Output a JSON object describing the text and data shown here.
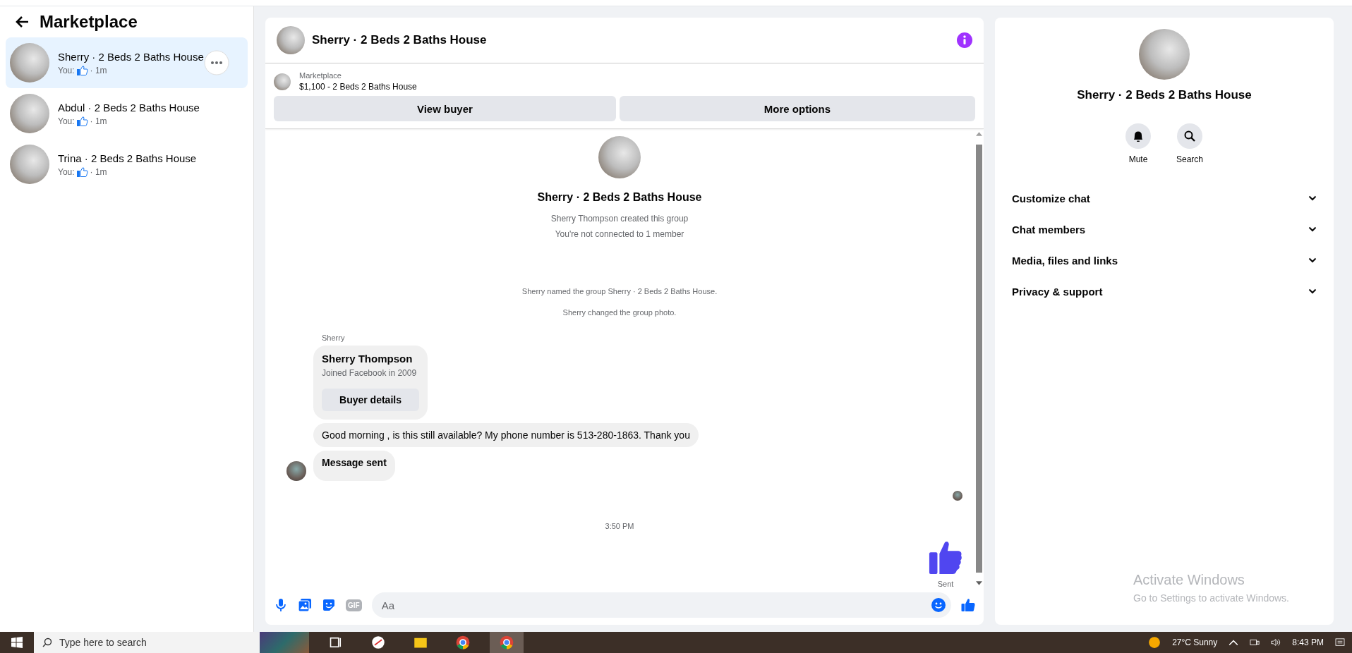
{
  "sidebar": {
    "title": "Marketplace",
    "conversations": [
      {
        "name": "Sherry · 2 Beds 2 Baths House",
        "preview": "You:",
        "time": "· 1m",
        "selected": true
      },
      {
        "name": "Abdul · 2 Beds 2 Baths House",
        "preview": "You:",
        "time": "· 1m",
        "selected": false
      },
      {
        "name": "Trina · 2 Beds 2 Baths House",
        "preview": "You:",
        "time": "· 1m",
        "selected": false
      }
    ]
  },
  "chat": {
    "title": "Sherry · 2 Beds 2 Baths House",
    "listing": {
      "label": "Marketplace",
      "title": "$1,100 - 2 Beds 2 Baths House"
    },
    "buttons": [
      "View buyer",
      "More options"
    ],
    "intro": {
      "title": "Sherry · 2 Beds 2 Baths House",
      "lines": [
        "Sherry Thompson created this group",
        "You're not connected to 1 member"
      ]
    },
    "notices": [
      "Sherry named the group Sherry · 2 Beds 2 Baths House.",
      "Sherry changed the group photo."
    ],
    "sender": "Sherry",
    "card": {
      "name": "Sherry Thompson",
      "subtitle": "Joined Facebook in 2009",
      "button": "Buyer details"
    },
    "bubbles": [
      {
        "text": "Good morning , is this still available? My phone number is 513-280-1863. Thank you",
        "bold": false
      },
      {
        "text": "Message sent",
        "bold": true
      }
    ],
    "time": "3:50 PM",
    "status": "Sent",
    "composer": {
      "gif": "GIF",
      "placeholder": "Aa"
    }
  },
  "details": {
    "title": "Sherry · 2 Beds 2 Baths House",
    "actions": [
      {
        "label": "Mute",
        "kind": "bell"
      },
      {
        "label": "Search",
        "kind": "search"
      }
    ],
    "sections": [
      {
        "label": "Customize chat",
        "expanded": false
      },
      {
        "label": "Chat members",
        "expanded": false
      },
      {
        "label": "Media, files and links",
        "expanded": false
      },
      {
        "label": "Privacy & support",
        "expanded": false
      }
    ],
    "activation": {
      "title": "Activate Windows",
      "text": "Go to Settings to activate Windows."
    }
  },
  "taskbar": {
    "search_placeholder": "Type here to search",
    "weather": "27°C  Sunny",
    "time": "8:43 PM"
  }
}
